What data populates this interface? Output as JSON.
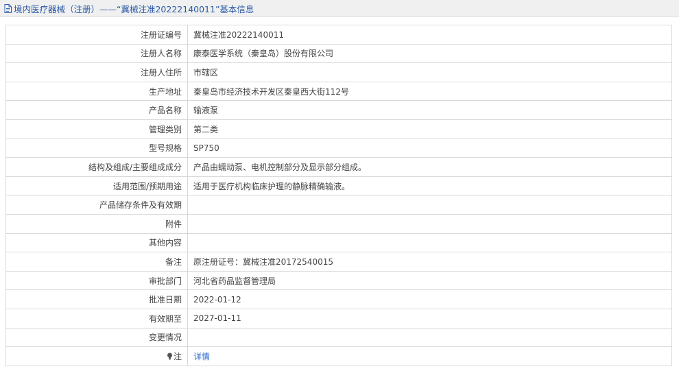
{
  "header": {
    "title": "境内医疗器械（注册）——“冀械注准20222140011”基本信息"
  },
  "rows": [
    {
      "label": "注册证编号",
      "value": "冀械注准20222140011"
    },
    {
      "label": "注册人名称",
      "value": "康泰医学系统（秦皇岛）股份有限公司"
    },
    {
      "label": "注册人住所",
      "value": "市辖区"
    },
    {
      "label": "生产地址",
      "value": "秦皇岛市经济技术开发区秦皇西大街112号"
    },
    {
      "label": "产品名称",
      "value": "输液泵"
    },
    {
      "label": "管理类别",
      "value": "第二类"
    },
    {
      "label": "型号规格",
      "value": "SP750"
    },
    {
      "label": "结构及组成/主要组成成分",
      "value": "产品由蠕动泵、电机控制部分及显示部分组成。"
    },
    {
      "label": "适用范围/预期用途",
      "value": "适用于医疗机构临床护理的静脉精确输液。"
    },
    {
      "label": "产品储存条件及有效期",
      "value": ""
    },
    {
      "label": "附件",
      "value": ""
    },
    {
      "label": "其他内容",
      "value": ""
    },
    {
      "label": "备注",
      "value": "原注册证号：冀械注准20172540015"
    },
    {
      "label": "审批部门",
      "value": "河北省药品监督管理局"
    },
    {
      "label": "批准日期",
      "value": "2022-01-12"
    },
    {
      "label": "有效期至",
      "value": "2027-01-11"
    },
    {
      "label": "变更情况",
      "value": ""
    }
  ],
  "note_row": {
    "label": "注",
    "icon": "lightbulb-icon",
    "link_text": "详情"
  },
  "colors": {
    "title": "#2a5aa8",
    "link": "#2f6dcf",
    "border": "#d9d9d9"
  }
}
